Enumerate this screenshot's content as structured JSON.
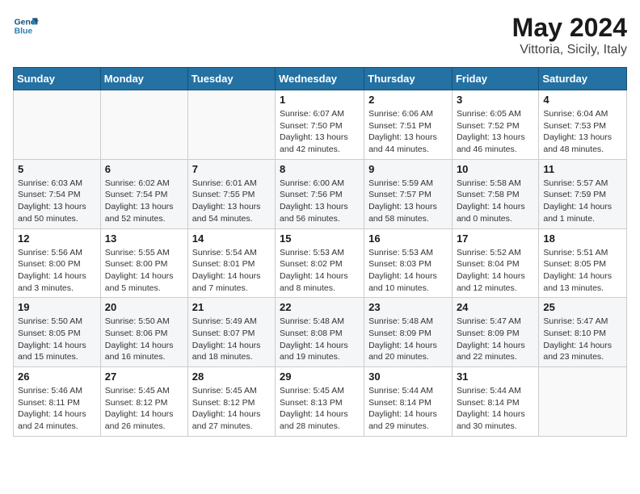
{
  "header": {
    "logo_line1": "General",
    "logo_line2": "Blue",
    "month_title": "May 2024",
    "subtitle": "Vittoria, Sicily, Italy"
  },
  "weekdays": [
    "Sunday",
    "Monday",
    "Tuesday",
    "Wednesday",
    "Thursday",
    "Friday",
    "Saturday"
  ],
  "weeks": [
    [
      {
        "day": "",
        "info": ""
      },
      {
        "day": "",
        "info": ""
      },
      {
        "day": "",
        "info": ""
      },
      {
        "day": "1",
        "info": "Sunrise: 6:07 AM\nSunset: 7:50 PM\nDaylight: 13 hours\nand 42 minutes."
      },
      {
        "day": "2",
        "info": "Sunrise: 6:06 AM\nSunset: 7:51 PM\nDaylight: 13 hours\nand 44 minutes."
      },
      {
        "day": "3",
        "info": "Sunrise: 6:05 AM\nSunset: 7:52 PM\nDaylight: 13 hours\nand 46 minutes."
      },
      {
        "day": "4",
        "info": "Sunrise: 6:04 AM\nSunset: 7:53 PM\nDaylight: 13 hours\nand 48 minutes."
      }
    ],
    [
      {
        "day": "5",
        "info": "Sunrise: 6:03 AM\nSunset: 7:54 PM\nDaylight: 13 hours\nand 50 minutes."
      },
      {
        "day": "6",
        "info": "Sunrise: 6:02 AM\nSunset: 7:54 PM\nDaylight: 13 hours\nand 52 minutes."
      },
      {
        "day": "7",
        "info": "Sunrise: 6:01 AM\nSunset: 7:55 PM\nDaylight: 13 hours\nand 54 minutes."
      },
      {
        "day": "8",
        "info": "Sunrise: 6:00 AM\nSunset: 7:56 PM\nDaylight: 13 hours\nand 56 minutes."
      },
      {
        "day": "9",
        "info": "Sunrise: 5:59 AM\nSunset: 7:57 PM\nDaylight: 13 hours\nand 58 minutes."
      },
      {
        "day": "10",
        "info": "Sunrise: 5:58 AM\nSunset: 7:58 PM\nDaylight: 14 hours\nand 0 minutes."
      },
      {
        "day": "11",
        "info": "Sunrise: 5:57 AM\nSunset: 7:59 PM\nDaylight: 14 hours\nand 1 minute."
      }
    ],
    [
      {
        "day": "12",
        "info": "Sunrise: 5:56 AM\nSunset: 8:00 PM\nDaylight: 14 hours\nand 3 minutes."
      },
      {
        "day": "13",
        "info": "Sunrise: 5:55 AM\nSunset: 8:00 PM\nDaylight: 14 hours\nand 5 minutes."
      },
      {
        "day": "14",
        "info": "Sunrise: 5:54 AM\nSunset: 8:01 PM\nDaylight: 14 hours\nand 7 minutes."
      },
      {
        "day": "15",
        "info": "Sunrise: 5:53 AM\nSunset: 8:02 PM\nDaylight: 14 hours\nand 8 minutes."
      },
      {
        "day": "16",
        "info": "Sunrise: 5:53 AM\nSunset: 8:03 PM\nDaylight: 14 hours\nand 10 minutes."
      },
      {
        "day": "17",
        "info": "Sunrise: 5:52 AM\nSunset: 8:04 PM\nDaylight: 14 hours\nand 12 minutes."
      },
      {
        "day": "18",
        "info": "Sunrise: 5:51 AM\nSunset: 8:05 PM\nDaylight: 14 hours\nand 13 minutes."
      }
    ],
    [
      {
        "day": "19",
        "info": "Sunrise: 5:50 AM\nSunset: 8:05 PM\nDaylight: 14 hours\nand 15 minutes."
      },
      {
        "day": "20",
        "info": "Sunrise: 5:50 AM\nSunset: 8:06 PM\nDaylight: 14 hours\nand 16 minutes."
      },
      {
        "day": "21",
        "info": "Sunrise: 5:49 AM\nSunset: 8:07 PM\nDaylight: 14 hours\nand 18 minutes."
      },
      {
        "day": "22",
        "info": "Sunrise: 5:48 AM\nSunset: 8:08 PM\nDaylight: 14 hours\nand 19 minutes."
      },
      {
        "day": "23",
        "info": "Sunrise: 5:48 AM\nSunset: 8:09 PM\nDaylight: 14 hours\nand 20 minutes."
      },
      {
        "day": "24",
        "info": "Sunrise: 5:47 AM\nSunset: 8:09 PM\nDaylight: 14 hours\nand 22 minutes."
      },
      {
        "day": "25",
        "info": "Sunrise: 5:47 AM\nSunset: 8:10 PM\nDaylight: 14 hours\nand 23 minutes."
      }
    ],
    [
      {
        "day": "26",
        "info": "Sunrise: 5:46 AM\nSunset: 8:11 PM\nDaylight: 14 hours\nand 24 minutes."
      },
      {
        "day": "27",
        "info": "Sunrise: 5:45 AM\nSunset: 8:12 PM\nDaylight: 14 hours\nand 26 minutes."
      },
      {
        "day": "28",
        "info": "Sunrise: 5:45 AM\nSunset: 8:12 PM\nDaylight: 14 hours\nand 27 minutes."
      },
      {
        "day": "29",
        "info": "Sunrise: 5:45 AM\nSunset: 8:13 PM\nDaylight: 14 hours\nand 28 minutes."
      },
      {
        "day": "30",
        "info": "Sunrise: 5:44 AM\nSunset: 8:14 PM\nDaylight: 14 hours\nand 29 minutes."
      },
      {
        "day": "31",
        "info": "Sunrise: 5:44 AM\nSunset: 8:14 PM\nDaylight: 14 hours\nand 30 minutes."
      },
      {
        "day": "",
        "info": ""
      }
    ]
  ]
}
